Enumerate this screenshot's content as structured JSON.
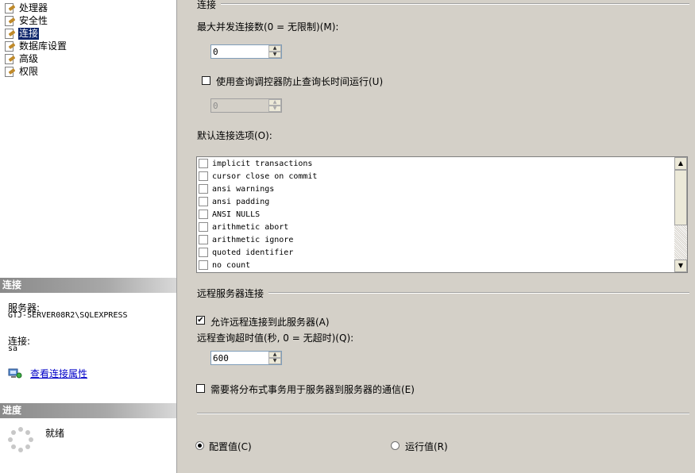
{
  "nav": {
    "items": [
      {
        "label": "处理器",
        "selected": false
      },
      {
        "label": "安全性",
        "selected": false
      },
      {
        "label": "连接",
        "selected": true
      },
      {
        "label": "数据库设置",
        "selected": false
      },
      {
        "label": "高级",
        "selected": false
      },
      {
        "label": "权限",
        "selected": false
      }
    ]
  },
  "connection_panel": {
    "header": "连接",
    "server_label": "服务器:",
    "server_value": "GTJ-SERVER08R2\\SQLEXPRESS",
    "conn_label": "连接:",
    "conn_value": "sa",
    "view_props_link": "查看连接属性"
  },
  "progress_panel": {
    "header": "进度",
    "status": "就绪"
  },
  "main": {
    "group_connections": "连接",
    "max_conn_label": "最大并发连接数(0 = 无限制)(M):",
    "max_conn_value": "0",
    "query_governor_label": "使用查询调控器防止查询长时间运行(U)",
    "query_governor_checked": false,
    "query_governor_value": "0",
    "default_options_label": "默认连接选项(O):",
    "options": [
      "implicit transactions",
      "cursor close on commit",
      "ansi warnings",
      "ansi padding",
      "ANSI NULLS",
      "arithmetic abort",
      "arithmetic ignore",
      "quoted identifier",
      "no count"
    ],
    "group_remote": "远程服务器连接",
    "allow_remote_label": "允许远程连接到此服务器(A)",
    "allow_remote_checked": true,
    "remote_timeout_label": "远程查询超时值(秒, 0 = 无超时)(Q):",
    "remote_timeout_value": "600",
    "distributed_tx_label": "需要将分布式事务用于服务器到服务器的通信(E)",
    "distributed_tx_checked": false,
    "config_value_label": "配置值(C)",
    "running_value_label": "运行值(R)",
    "selected_mode": "config"
  }
}
